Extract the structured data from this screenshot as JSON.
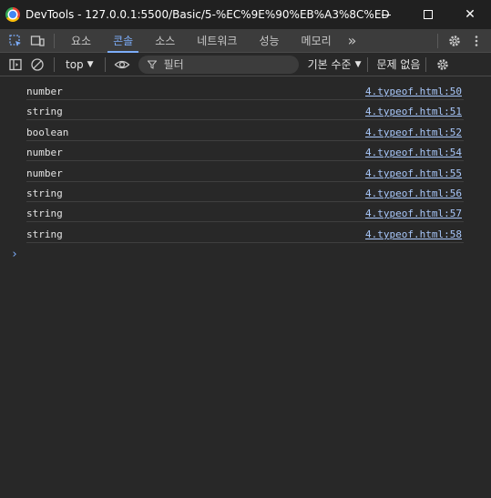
{
  "window": {
    "title": "DevTools - 127.0.0.1:5500/Basic/5-%EC%9E%90%EB%A3%8C%ED%...",
    "close_glyph": "✕"
  },
  "tabs": [
    {
      "label": "요소",
      "active": false
    },
    {
      "label": "콘솔",
      "active": true
    },
    {
      "label": "소스",
      "active": false
    },
    {
      "label": "네트워크",
      "active": false
    },
    {
      "label": "성능",
      "active": false
    },
    {
      "label": "메모리",
      "active": false
    }
  ],
  "more_tabs": "»",
  "toolbar": {
    "context": "top",
    "filter_placeholder": "필터",
    "levels": "기본 수준",
    "issues": "문제 없음"
  },
  "messages": [
    {
      "text": "number",
      "source": "4.typeof.html:50"
    },
    {
      "text": "string",
      "source": "4.typeof.html:51"
    },
    {
      "text": "boolean",
      "source": "4.typeof.html:52"
    },
    {
      "text": "number",
      "source": "4.typeof.html:54"
    },
    {
      "text": "number",
      "source": "4.typeof.html:55"
    },
    {
      "text": "string",
      "source": "4.typeof.html:56"
    },
    {
      "text": "string",
      "source": "4.typeof.html:57"
    },
    {
      "text": "string",
      "source": "4.typeof.html:58"
    }
  ],
  "prompt_glyph": "›",
  "colors": {
    "accent": "#7cacf8",
    "link": "#a8c7fa",
    "background": "#282828"
  }
}
